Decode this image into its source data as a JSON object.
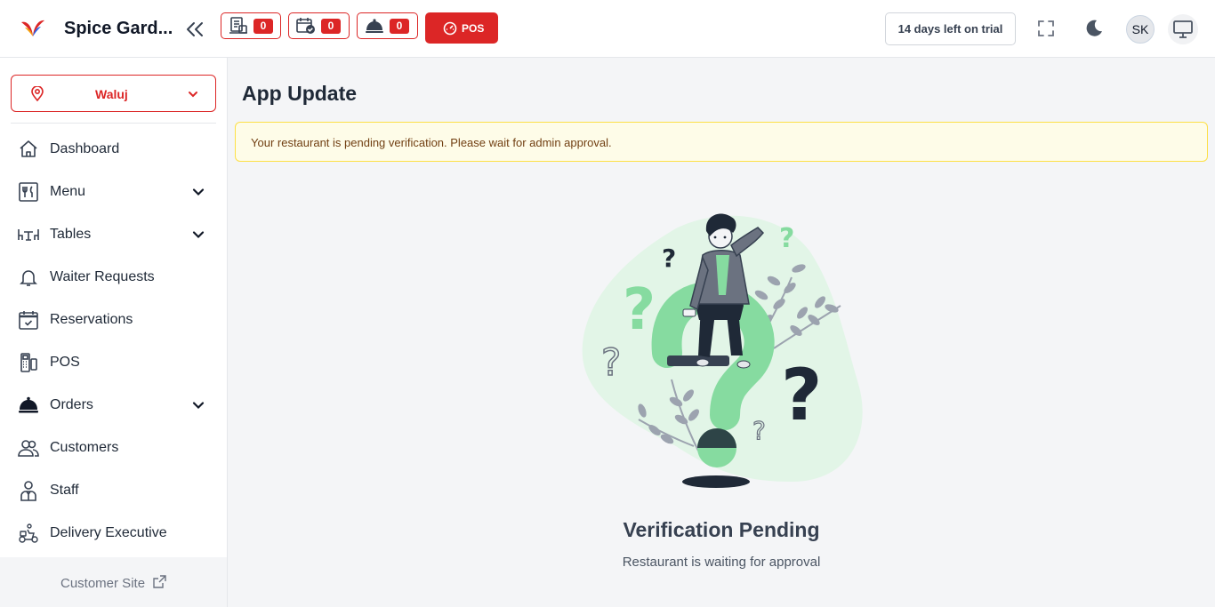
{
  "header": {
    "app_name": "Spice Gard...",
    "counters": [
      {
        "icon": "kot-icon",
        "count": "0"
      },
      {
        "icon": "reservation-calendar-icon",
        "count": "0"
      },
      {
        "icon": "cloche-icon",
        "count": "0"
      }
    ],
    "pos_label": "POS",
    "trial_text": "14 days left on trial",
    "avatar_initials": "SK"
  },
  "sidebar": {
    "branch": "Waluj",
    "items": [
      {
        "label": "Dashboard",
        "icon": "home-icon"
      },
      {
        "label": "Menu",
        "icon": "menu-utensils-icon",
        "expandable": true
      },
      {
        "label": "Tables",
        "icon": "tables-icon",
        "expandable": true
      },
      {
        "label": "Waiter Requests",
        "icon": "bell-icon"
      },
      {
        "label": "Reservations",
        "icon": "calendar-check-icon"
      },
      {
        "label": "POS",
        "icon": "pos-terminal-icon"
      },
      {
        "label": "Orders",
        "icon": "cloche-icon",
        "expandable": true
      },
      {
        "label": "Customers",
        "icon": "users-icon"
      },
      {
        "label": "Staff",
        "icon": "staff-icon"
      },
      {
        "label": "Delivery Executive",
        "icon": "scooter-icon"
      }
    ],
    "customer_site": "Customer Site"
  },
  "main": {
    "title": "App Update",
    "alert": "Your restaurant is pending verification. Please wait for admin approval.",
    "heading": "Verification Pending",
    "subheading": "Restaurant is waiting for approval"
  },
  "colors": {
    "accent": "#dc2626",
    "alert_bg": "#fefce8",
    "alert_border": "#fde047",
    "illustration_green": "#86dba0"
  }
}
